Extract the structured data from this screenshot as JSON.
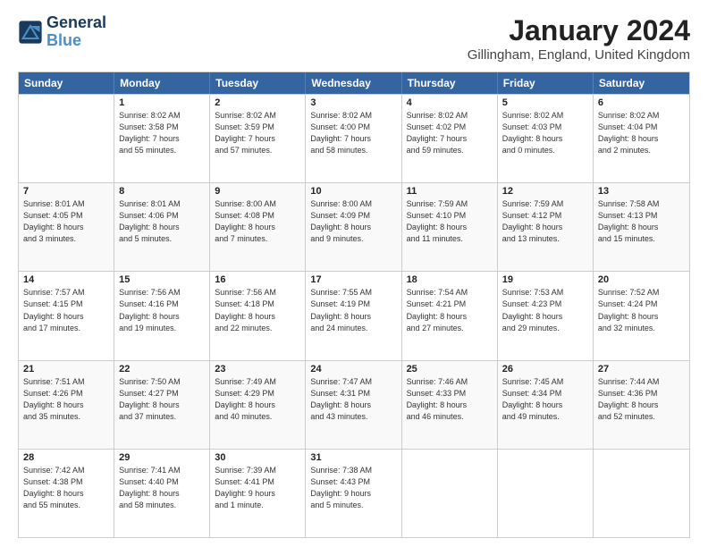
{
  "header": {
    "logo_line1": "General",
    "logo_line2": "Blue",
    "title": "January 2024",
    "subtitle": "Gillingham, England, United Kingdom"
  },
  "weekdays": [
    "Sunday",
    "Monday",
    "Tuesday",
    "Wednesday",
    "Thursday",
    "Friday",
    "Saturday"
  ],
  "weeks": [
    [
      {
        "day": "",
        "info": ""
      },
      {
        "day": "1",
        "info": "Sunrise: 8:02 AM\nSunset: 3:58 PM\nDaylight: 7 hours\nand 55 minutes."
      },
      {
        "day": "2",
        "info": "Sunrise: 8:02 AM\nSunset: 3:59 PM\nDaylight: 7 hours\nand 57 minutes."
      },
      {
        "day": "3",
        "info": "Sunrise: 8:02 AM\nSunset: 4:00 PM\nDaylight: 7 hours\nand 58 minutes."
      },
      {
        "day": "4",
        "info": "Sunrise: 8:02 AM\nSunset: 4:02 PM\nDaylight: 7 hours\nand 59 minutes."
      },
      {
        "day": "5",
        "info": "Sunrise: 8:02 AM\nSunset: 4:03 PM\nDaylight: 8 hours\nand 0 minutes."
      },
      {
        "day": "6",
        "info": "Sunrise: 8:02 AM\nSunset: 4:04 PM\nDaylight: 8 hours\nand 2 minutes."
      }
    ],
    [
      {
        "day": "7",
        "info": "Sunrise: 8:01 AM\nSunset: 4:05 PM\nDaylight: 8 hours\nand 3 minutes."
      },
      {
        "day": "8",
        "info": "Sunrise: 8:01 AM\nSunset: 4:06 PM\nDaylight: 8 hours\nand 5 minutes."
      },
      {
        "day": "9",
        "info": "Sunrise: 8:00 AM\nSunset: 4:08 PM\nDaylight: 8 hours\nand 7 minutes."
      },
      {
        "day": "10",
        "info": "Sunrise: 8:00 AM\nSunset: 4:09 PM\nDaylight: 8 hours\nand 9 minutes."
      },
      {
        "day": "11",
        "info": "Sunrise: 7:59 AM\nSunset: 4:10 PM\nDaylight: 8 hours\nand 11 minutes."
      },
      {
        "day": "12",
        "info": "Sunrise: 7:59 AM\nSunset: 4:12 PM\nDaylight: 8 hours\nand 13 minutes."
      },
      {
        "day": "13",
        "info": "Sunrise: 7:58 AM\nSunset: 4:13 PM\nDaylight: 8 hours\nand 15 minutes."
      }
    ],
    [
      {
        "day": "14",
        "info": "Sunrise: 7:57 AM\nSunset: 4:15 PM\nDaylight: 8 hours\nand 17 minutes."
      },
      {
        "day": "15",
        "info": "Sunrise: 7:56 AM\nSunset: 4:16 PM\nDaylight: 8 hours\nand 19 minutes."
      },
      {
        "day": "16",
        "info": "Sunrise: 7:56 AM\nSunset: 4:18 PM\nDaylight: 8 hours\nand 22 minutes."
      },
      {
        "day": "17",
        "info": "Sunrise: 7:55 AM\nSunset: 4:19 PM\nDaylight: 8 hours\nand 24 minutes."
      },
      {
        "day": "18",
        "info": "Sunrise: 7:54 AM\nSunset: 4:21 PM\nDaylight: 8 hours\nand 27 minutes."
      },
      {
        "day": "19",
        "info": "Sunrise: 7:53 AM\nSunset: 4:23 PM\nDaylight: 8 hours\nand 29 minutes."
      },
      {
        "day": "20",
        "info": "Sunrise: 7:52 AM\nSunset: 4:24 PM\nDaylight: 8 hours\nand 32 minutes."
      }
    ],
    [
      {
        "day": "21",
        "info": "Sunrise: 7:51 AM\nSunset: 4:26 PM\nDaylight: 8 hours\nand 35 minutes."
      },
      {
        "day": "22",
        "info": "Sunrise: 7:50 AM\nSunset: 4:27 PM\nDaylight: 8 hours\nand 37 minutes."
      },
      {
        "day": "23",
        "info": "Sunrise: 7:49 AM\nSunset: 4:29 PM\nDaylight: 8 hours\nand 40 minutes."
      },
      {
        "day": "24",
        "info": "Sunrise: 7:47 AM\nSunset: 4:31 PM\nDaylight: 8 hours\nand 43 minutes."
      },
      {
        "day": "25",
        "info": "Sunrise: 7:46 AM\nSunset: 4:33 PM\nDaylight: 8 hours\nand 46 minutes."
      },
      {
        "day": "26",
        "info": "Sunrise: 7:45 AM\nSunset: 4:34 PM\nDaylight: 8 hours\nand 49 minutes."
      },
      {
        "day": "27",
        "info": "Sunrise: 7:44 AM\nSunset: 4:36 PM\nDaylight: 8 hours\nand 52 minutes."
      }
    ],
    [
      {
        "day": "28",
        "info": "Sunrise: 7:42 AM\nSunset: 4:38 PM\nDaylight: 8 hours\nand 55 minutes."
      },
      {
        "day": "29",
        "info": "Sunrise: 7:41 AM\nSunset: 4:40 PM\nDaylight: 8 hours\nand 58 minutes."
      },
      {
        "day": "30",
        "info": "Sunrise: 7:39 AM\nSunset: 4:41 PM\nDaylight: 9 hours\nand 1 minute."
      },
      {
        "day": "31",
        "info": "Sunrise: 7:38 AM\nSunset: 4:43 PM\nDaylight: 9 hours\nand 5 minutes."
      },
      {
        "day": "",
        "info": ""
      },
      {
        "day": "",
        "info": ""
      },
      {
        "day": "",
        "info": ""
      }
    ]
  ]
}
